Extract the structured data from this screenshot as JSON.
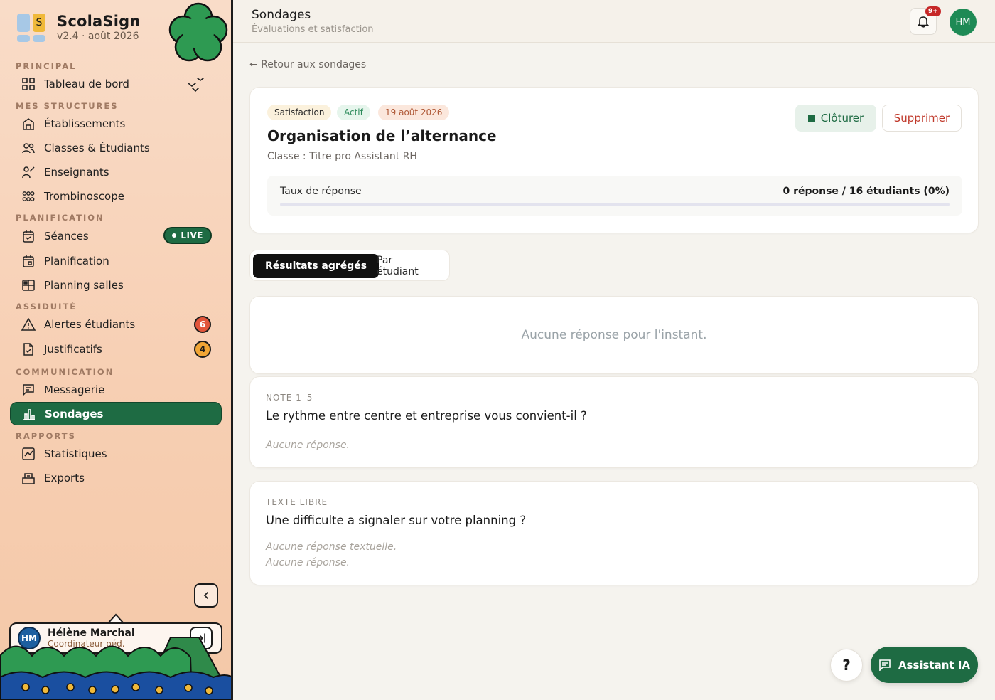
{
  "brand": {
    "name": "ScolaSign",
    "version": "v2.4 · août 2026",
    "logo_letter": "S"
  },
  "colors": {
    "accent": "#1e6b43",
    "danger": "#c0392b",
    "sidebar_bg": "#f7cfb3"
  },
  "sidebar": {
    "sections": {
      "principal": "PRINCIPAL",
      "structures": "MES STRUCTURES",
      "planification": "PLANIFICATION",
      "assiduite": "ASSIDUITÉ",
      "communication": "COMMUNICATION",
      "rapports": "RAPPORTS"
    },
    "items": {
      "dashboard": {
        "label": "Tableau de bord",
        "icon": "grid-icon"
      },
      "etablissements": {
        "label": "Établissements",
        "icon": "building-icon"
      },
      "classes": {
        "label": "Classes & Étudiants",
        "icon": "users-icon"
      },
      "enseignants": {
        "label": "Enseignants",
        "icon": "teacher-icon"
      },
      "trombinoscope": {
        "label": "Trombinoscope",
        "icon": "faces-grid-icon"
      },
      "seances": {
        "label": "Séances",
        "icon": "calendar-check-icon",
        "badge": "LIVE"
      },
      "planification": {
        "label": "Planification",
        "icon": "calendar-icon"
      },
      "planning_salles": {
        "label": "Planning salles",
        "icon": "rooms-icon"
      },
      "alertes": {
        "label": "Alertes étudiants",
        "icon": "warning-icon",
        "count": "6"
      },
      "justificatifs": {
        "label": "Justificatifs",
        "icon": "document-check-icon",
        "count": "4"
      },
      "messagerie": {
        "label": "Messagerie",
        "icon": "message-icon"
      },
      "sondages": {
        "label": "Sondages",
        "icon": "bar-chart-icon",
        "active": true
      },
      "statistiques": {
        "label": "Statistiques",
        "icon": "line-chart-icon"
      },
      "exports": {
        "label": "Exports",
        "icon": "export-icon"
      }
    },
    "user": {
      "initials": "HM",
      "name": "Hélène Marchal",
      "role": "Coordinateur péd."
    }
  },
  "topbar": {
    "title": "Sondages",
    "subtitle": "Évaluations et satisfaction",
    "notifications_badge": "9+",
    "avatar_initials": "HM"
  },
  "main": {
    "back_link": "← Retour aux sondages",
    "survey": {
      "tags": [
        "Satisfaction",
        "Actif",
        "19 août 2026"
      ],
      "title": "Organisation de l’alternance",
      "class_line": "Classe : Titre pro Assistant RH",
      "close_label": "Clôturer",
      "delete_label": "Supprimer",
      "rate_label": "Taux de réponse",
      "rate_value": "0 réponse / 16 étudiants (0%)",
      "rate_fraction": 0
    },
    "tabs": [
      "Résultats agrégés",
      "Par étudiant"
    ],
    "empty_message": "Aucune réponse pour l'instant.",
    "questions": [
      {
        "type": "NOTE 1–5",
        "text": "Le rythme entre centre et entreprise vous convient-il ?",
        "notes": [
          "Aucune réponse."
        ]
      },
      {
        "type": "TEXTE LIBRE",
        "text": "Une difficulte a signaler sur votre planning ?",
        "notes": [
          "Aucune réponse textuelle.",
          "Aucune réponse."
        ]
      }
    ]
  },
  "fab": {
    "help": "?",
    "assistant": "Assistant IA"
  }
}
